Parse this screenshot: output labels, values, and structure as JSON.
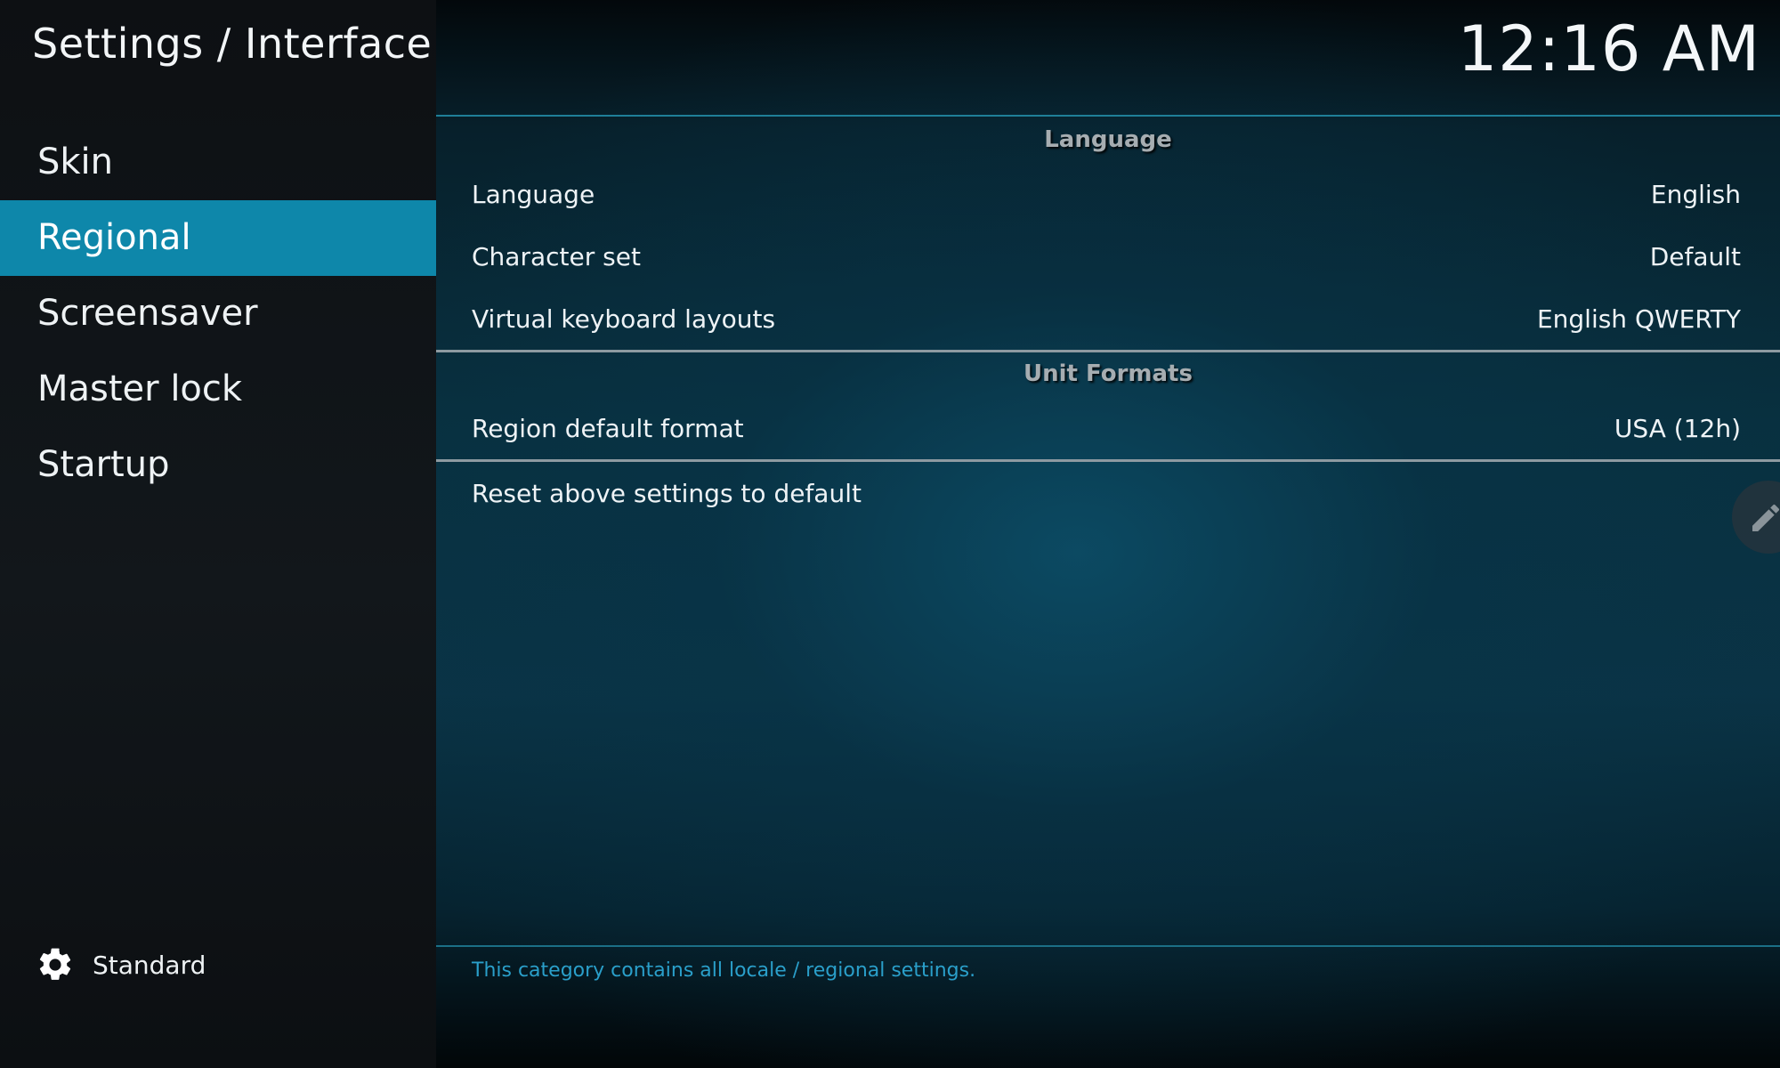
{
  "header": {
    "breadcrumb": "Settings / Interface",
    "clock": "12:16 AM"
  },
  "sidebar": {
    "items": [
      {
        "label": "Skin"
      },
      {
        "label": "Regional",
        "selected": true
      },
      {
        "label": "Screensaver"
      },
      {
        "label": "Master lock"
      },
      {
        "label": "Startup"
      }
    ],
    "settings_level": {
      "icon": "gear-icon",
      "label": "Standard"
    }
  },
  "main": {
    "groups": {
      "language": {
        "title": "Language",
        "rows": [
          {
            "label": "Language",
            "value": "English"
          },
          {
            "label": "Character set",
            "value": "Default"
          },
          {
            "label": "Virtual keyboard layouts",
            "value": "English QWERTY"
          }
        ]
      },
      "unit_formats": {
        "title": "Unit Formats",
        "rows": [
          {
            "label": "Region default format",
            "value": "USA (12h)"
          }
        ]
      }
    },
    "reset_label": "Reset above settings to default",
    "edit_icon": "pencil-icon",
    "description": "This category contains all locale / regional settings."
  },
  "colors": {
    "accent": "#0e87aa",
    "description_text": "#2a9fca",
    "group_title": "#a6adb1"
  }
}
